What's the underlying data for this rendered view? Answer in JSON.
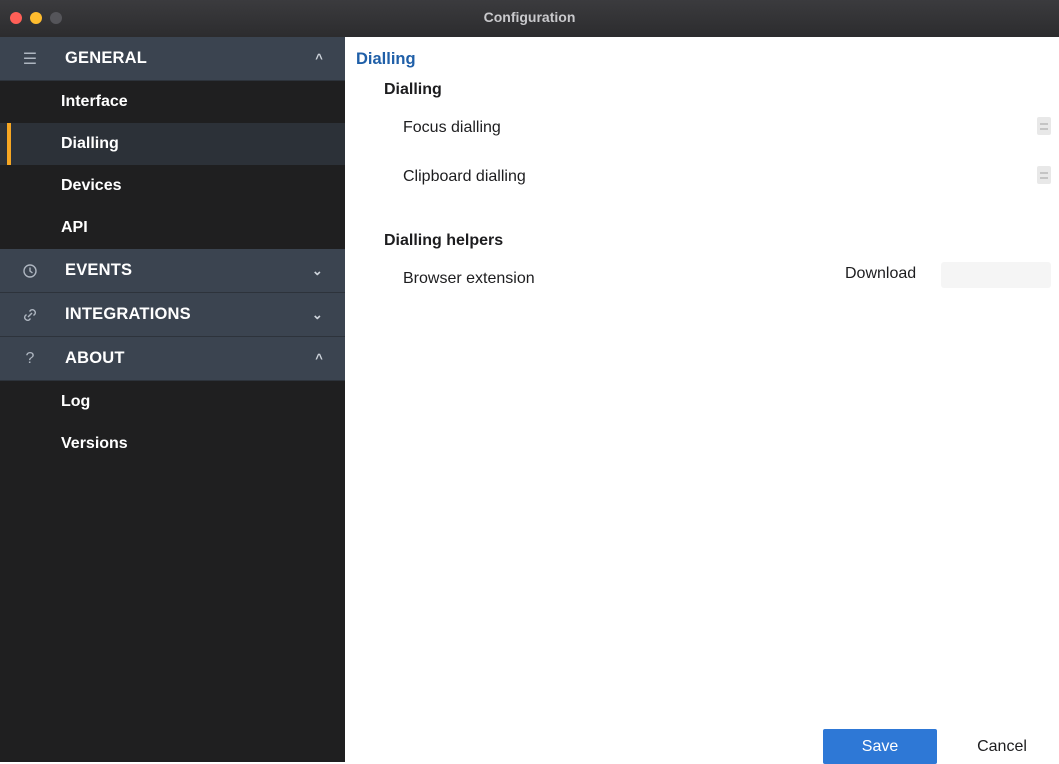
{
  "window": {
    "title": "Configuration"
  },
  "sidebar": {
    "general": {
      "label": "GENERAL",
      "icon": "menu-icon",
      "chevron": "^",
      "items": [
        {
          "label": "Interface"
        },
        {
          "label": "Dialling",
          "active": true
        },
        {
          "label": "Devices"
        },
        {
          "label": "API"
        }
      ]
    },
    "events": {
      "label": "EVENTS",
      "icon": "clock-icon",
      "chevron": "⌄"
    },
    "integrations": {
      "label": "INTEGRATIONS",
      "icon": "link-icon",
      "chevron": "⌄"
    },
    "about": {
      "label": "ABOUT",
      "icon": "question-icon",
      "chevron": "^",
      "items": [
        {
          "label": "Log"
        },
        {
          "label": "Versions"
        }
      ]
    }
  },
  "main": {
    "title": "Dialling",
    "dialling_group": {
      "title": "Dialling",
      "focus_label": "Focus dialling",
      "clipboard_label": "Clipboard dialling"
    },
    "helpers_group": {
      "title": "Dialling helpers",
      "browser_label": "Browser extension",
      "download_label": "Download"
    }
  },
  "footer": {
    "save_label": "Save",
    "cancel_label": "Cancel"
  },
  "colors": {
    "accent": "#f5a623",
    "primary": "#2e78d6",
    "section_bg": "#3b4450",
    "sidebar_bg": "#1f1f20"
  }
}
